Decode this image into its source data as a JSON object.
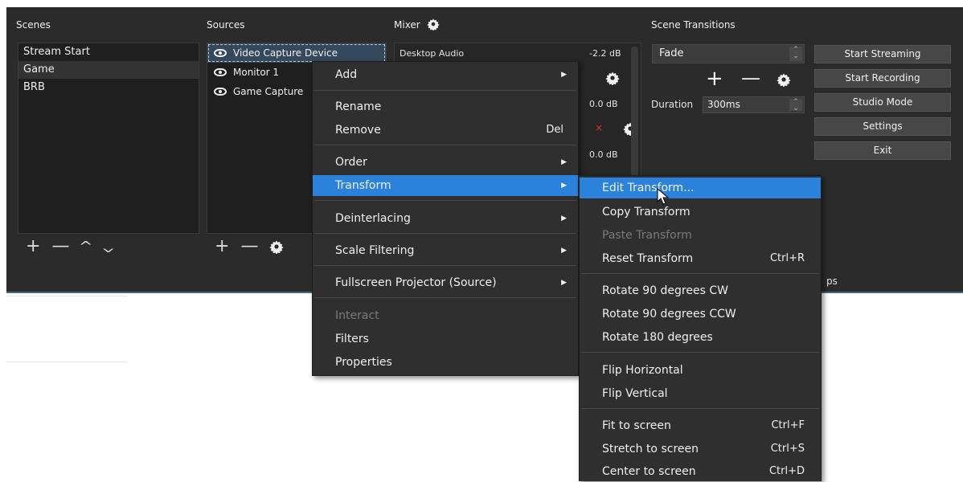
{
  "scenes": {
    "title": "Scenes",
    "items": [
      "Stream Start",
      "Game",
      "BRB"
    ]
  },
  "sources": {
    "title": "Sources",
    "items": [
      "Video Capture Device",
      "Monitor 1",
      "Game Capture"
    ]
  },
  "mixer": {
    "title": "Mixer",
    "channel_name": "Desktop Audio",
    "db_values": [
      "-2.2 dB",
      "0.0 dB",
      "0.0 dB"
    ]
  },
  "transitions": {
    "title": "Scene Transitions",
    "selected": "Fade",
    "duration_label": "Duration",
    "duration_value": "300ms"
  },
  "controls": {
    "start_streaming": "Start Streaming",
    "start_recording": "Start Recording",
    "studio_mode": "Studio Mode",
    "settings": "Settings",
    "exit": "Exit",
    "partial_label": "ps"
  },
  "context_menu": {
    "add": "Add",
    "rename": "Rename",
    "remove": "Remove",
    "remove_shortcut": "Del",
    "order": "Order",
    "transform": "Transform",
    "deinterlacing": "Deinterlacing",
    "scale_filtering": "Scale Filtering",
    "fullscreen_projector": "Fullscreen Projector (Source)",
    "interact": "Interact",
    "filters": "Filters",
    "properties": "Properties"
  },
  "transform_menu": {
    "edit_transform": "Edit Transform...",
    "copy_transform": "Copy Transform",
    "paste_transform": "Paste Transform",
    "reset_transform": "Reset Transform",
    "reset_shortcut": "Ctrl+R",
    "rotate_cw": "Rotate 90 degrees CW",
    "rotate_ccw": "Rotate 90 degrees CCW",
    "rotate_180": "Rotate 180 degrees",
    "flip_horizontal": "Flip Horizontal",
    "flip_vertical": "Flip Vertical",
    "fit_to_screen": "Fit to screen",
    "fit_shortcut": "Ctrl+F",
    "stretch_to_screen": "Stretch to screen",
    "stretch_shortcut": "Ctrl+S",
    "center_to_screen": "Center to screen",
    "center_shortcut": "Ctrl+D"
  },
  "colors": {
    "window_bg": "#2b2b2b",
    "panel_bg": "#1f1f1f",
    "menu_bg": "#2f2f2f",
    "highlight": "#2a82da"
  }
}
